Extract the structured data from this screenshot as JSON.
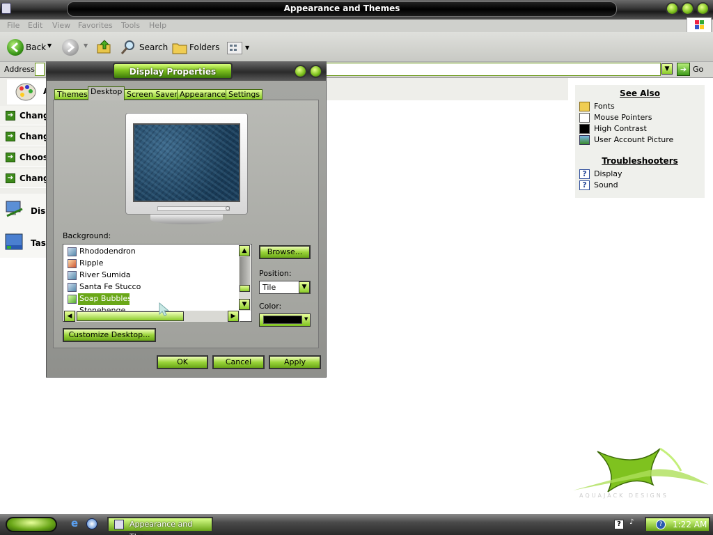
{
  "window": {
    "title": "Appearance and Themes"
  },
  "menu": [
    "File",
    "Edit",
    "View",
    "Favorites",
    "Tools",
    "Help"
  ],
  "toolbar": {
    "back": "Back",
    "search": "Search",
    "folders": "Folders"
  },
  "address": {
    "label": "Address",
    "go": "Go"
  },
  "tasks": [
    "Change",
    "Change",
    "Choose",
    "Change"
  ],
  "panels": [
    "Disp",
    "Tasl"
  ],
  "see_also": {
    "heading": "See Also",
    "items": [
      "Fonts",
      "Mouse Pointers",
      "High Contrast",
      "User Account Picture"
    ]
  },
  "troubleshooters": {
    "heading": "Troubleshooters",
    "items": [
      "Display",
      "Sound"
    ]
  },
  "dialog": {
    "title": "Display Properties",
    "tabs": [
      "Themes",
      "Desktop",
      "Screen Saver",
      "Appearance",
      "Settings"
    ],
    "active_tab": "Desktop",
    "background_label": "Background:",
    "backgrounds": [
      "Rhododendron",
      "Ripple",
      "River Sumida",
      "Santa Fe Stucco",
      "Soap Bubbles",
      "Stonehenge"
    ],
    "selected_background": "Soap Bubbles",
    "browse": "Browse...",
    "position_label": "Position:",
    "position_value": "Tile",
    "color_label": "Color:",
    "color_value": "#000000",
    "customize": "Customize Desktop...",
    "ok": "OK",
    "cancel": "Cancel",
    "apply": "Apply"
  },
  "taskbar": {
    "task": "Appearance and The...",
    "time": "1:22 AM"
  },
  "branding": {
    "logo_text": "AQUAJACK DESIGNS"
  },
  "colors": {
    "accent": "#7fc21f",
    "dark": "#2a2a2a"
  }
}
